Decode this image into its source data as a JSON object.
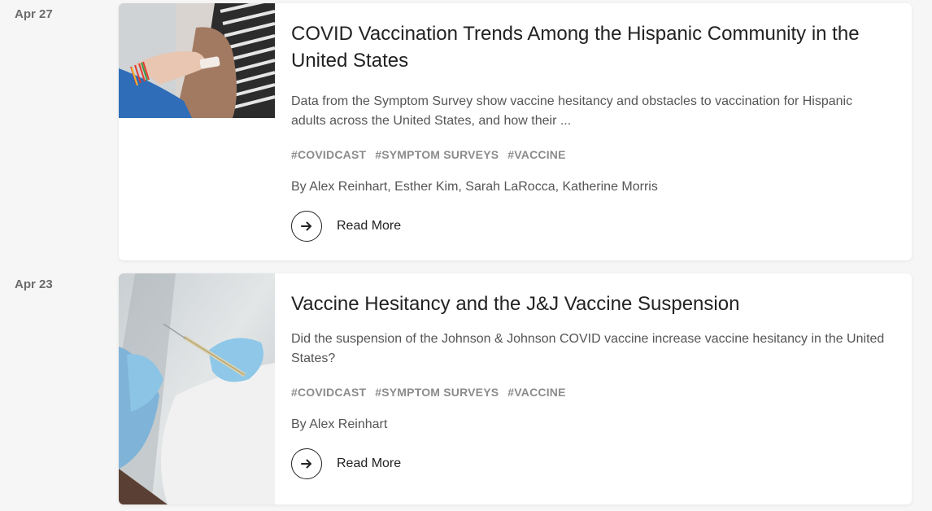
{
  "posts": [
    {
      "date": "Apr 27",
      "title": "COVID Vaccination Trends Among the Hispanic Community in the United States",
      "excerpt": "Data from the Symptom Survey show vaccine hesitancy and obstacles to vaccination for Hispanic adults across the United States, and how their ...",
      "tags": [
        "#COVIDCAST",
        "#SYMPTOM SURVEYS",
        "#VACCINE"
      ],
      "authors": "By Alex Reinhart, Esther Kim, Sarah LaRocca, Katherine Morris",
      "read_more": "Read More",
      "thumbnail_icon": "vaccination-arm-photo"
    },
    {
      "date": "Apr 23",
      "title": "Vaccine Hesitancy and the J&J Vaccine Suspension",
      "excerpt": "Did the suspension of the Johnson & Johnson COVID vaccine increase vaccine hesitancy in the United States?",
      "tags": [
        "#COVIDCAST",
        "#SYMPTOM SURVEYS",
        "#VACCINE"
      ],
      "authors": "By Alex Reinhart",
      "read_more": "Read More",
      "thumbnail_icon": "gloved-hands-syringe-photo"
    }
  ]
}
